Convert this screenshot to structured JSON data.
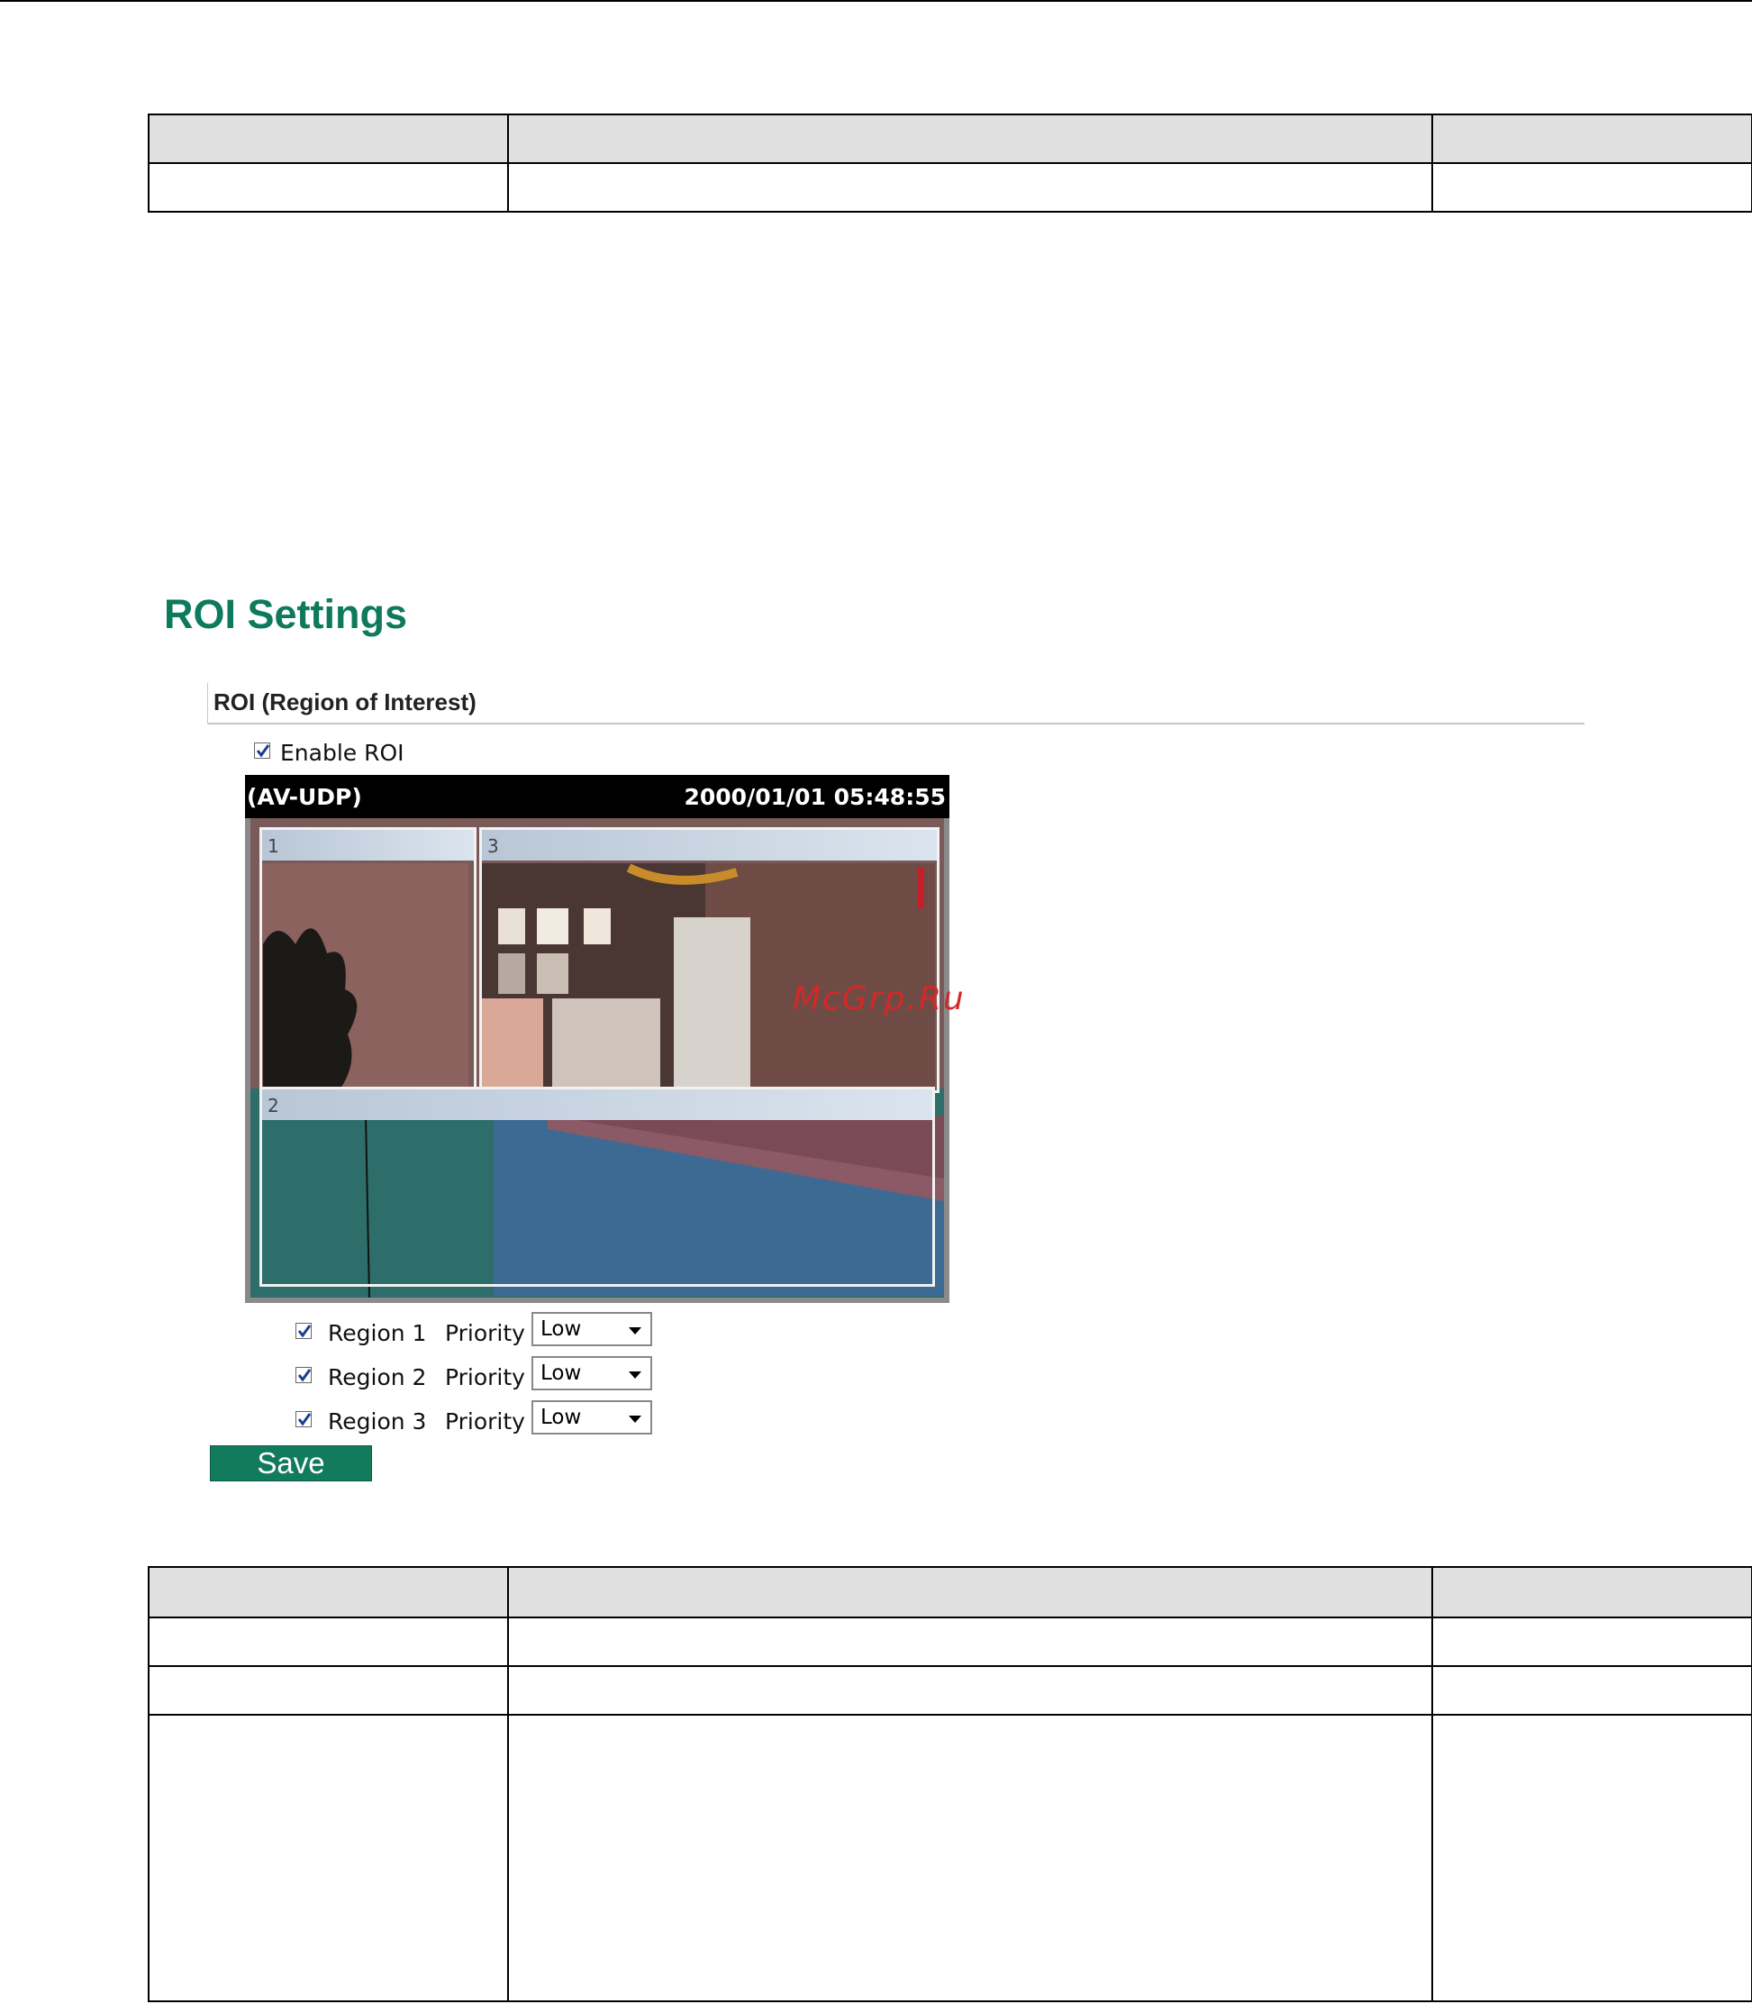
{
  "page": {
    "title": "ROI Settings",
    "watermark": "McGrp.Ru"
  },
  "section": {
    "title": "ROI (Region of Interest)"
  },
  "enable_roi": {
    "label": "Enable ROI",
    "checked": true
  },
  "viewer": {
    "stream_label": "(AV-UDP)",
    "timestamp": "2000/01/01 05:48:55",
    "regions": [
      {
        "number": "1"
      },
      {
        "number": "3"
      },
      {
        "number": "2"
      }
    ]
  },
  "region_settings": [
    {
      "label": "Region 1",
      "checked": true,
      "priority_label": "Priority",
      "priority_value": "Low"
    },
    {
      "label": "Region 2",
      "checked": true,
      "priority_label": "Priority",
      "priority_value": "Low"
    },
    {
      "label": "Region 3",
      "checked": true,
      "priority_label": "Priority",
      "priority_value": "Low"
    }
  ],
  "buttons": {
    "save": "Save"
  },
  "colors": {
    "title": "#0e7a5c",
    "save_button": "#127b5c",
    "table_header": "#e0e0e0",
    "watermark": "#d32828"
  }
}
